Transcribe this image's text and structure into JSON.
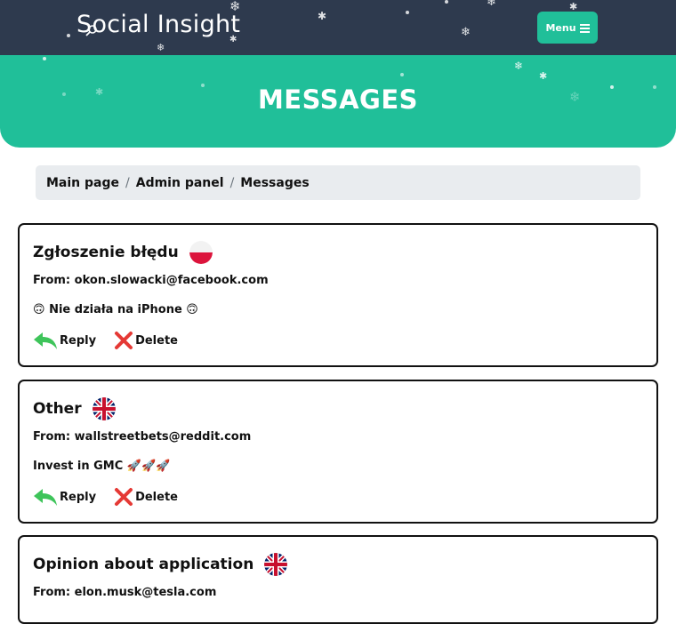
{
  "navbar": {
    "brand": "Social Insight",
    "menu_label": "Menu",
    "menu_icon": "hamburger-icon"
  },
  "hero": {
    "title": "MESSAGES"
  },
  "breadcrumb": {
    "items": [
      "Main page",
      "Admin panel",
      "Messages"
    ],
    "separator": "/"
  },
  "messages": [
    {
      "subject": "Zgłoszenie błędu",
      "flag": "poland-flag-icon",
      "from": "From: okon.slowacki@facebook.com",
      "body": "🙃 Nie działa na iPhone 🙃",
      "reply_label": "Reply",
      "delete_label": "Delete"
    },
    {
      "subject": "Other",
      "flag": "uk-flag-icon",
      "from": "From: wallstreetbets@reddit.com",
      "body": "Invest in GMC 🚀🚀🚀",
      "reply_label": "Reply",
      "delete_label": "Delete"
    },
    {
      "subject": "Opinion about application",
      "flag": "uk-flag-icon",
      "from": "From: elon.musk@tesla.com"
    }
  ],
  "colors": {
    "navbar_bg": "#2e3a4e",
    "accent": "#20bf99",
    "reply_icon": "#3ec45a",
    "delete_icon": "#e53935"
  }
}
